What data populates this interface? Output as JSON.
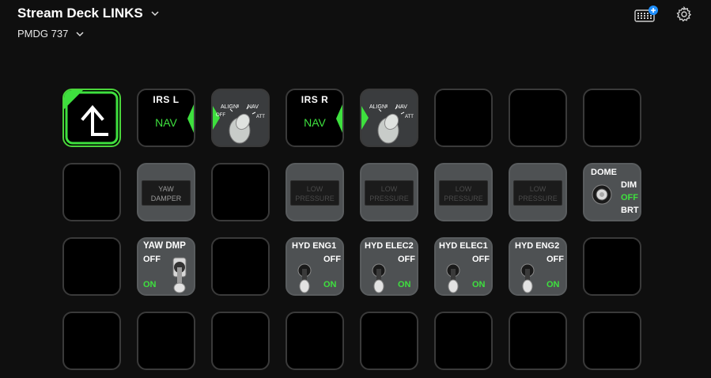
{
  "header": {
    "title": "Stream Deck LINKS",
    "profile": "PMDG 737"
  },
  "icons": {
    "store": "keypad-plus-icon",
    "settings": "gear-icon",
    "accent": "#1e8fff"
  },
  "keys": {
    "irs_l": {
      "title": "IRS  L",
      "mode": "NAV"
    },
    "irs_r": {
      "title": "IRS  R",
      "mode": "NAV"
    },
    "knob": {
      "align": "ALIGN",
      "nav": "NAV",
      "off": "OFF",
      "att": "ATT"
    },
    "yaw_damper_annun": {
      "line1": "YAW",
      "line2": "DAMPER"
    },
    "low_pressure": {
      "line1": "LOW",
      "line2": "PRESSURE"
    },
    "dome": {
      "title": "DOME",
      "dim": "DIM",
      "off": "OFF",
      "brt": "BRT"
    },
    "yaw_dmp": {
      "title": "YAW DMP",
      "off": "OFF",
      "on": "ON"
    },
    "hyd_eng1": {
      "title": "HYD ENG1",
      "off": "OFF",
      "on": "ON"
    },
    "hyd_elec2": {
      "title": "HYD ELEC2",
      "off": "OFF",
      "on": "ON"
    },
    "hyd_elec1": {
      "title": "HYD ELEC1",
      "off": "OFF",
      "on": "ON"
    },
    "hyd_eng2": {
      "title": "HYD ENG2",
      "off": "OFF",
      "on": "ON"
    }
  },
  "colors": {
    "active_green": "#3ee03e",
    "key_gray": "#4e5153"
  }
}
